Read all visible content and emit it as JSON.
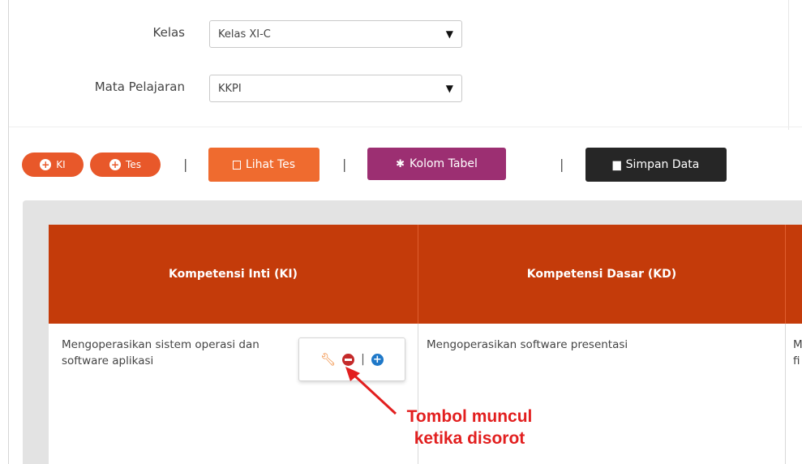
{
  "form": {
    "kelas": {
      "label": "Kelas",
      "value": "Kelas XI-C"
    },
    "mapel": {
      "label": "Mata Pelajaran",
      "value": "KKPI"
    }
  },
  "toolbar": {
    "ki_label": "KI",
    "tes_label": "Tes",
    "lihat_tes_label": "Lihat Tes",
    "kolom_tabel_label": "Kolom Tabel",
    "simpan_data_label": "Simpan Data",
    "separator": "|"
  },
  "table": {
    "headers": [
      "Kompetensi Inti (KI)",
      "Kompetensi Dasar (KD)"
    ],
    "row": {
      "ki": "Mengoperasikan sistem operasi dan software aplikasi",
      "kd": "Mengoperasikan software presentasi",
      "col3_partial": "M\nfi"
    }
  },
  "callout": {
    "line1": "Tombol muncul",
    "line2": "ketika disorot"
  },
  "colors": {
    "header_bg": "#c43b0a",
    "accent_orange": "#ef6b2f",
    "accent_purple": "#9c2f72",
    "callout": "#e21f1f"
  }
}
